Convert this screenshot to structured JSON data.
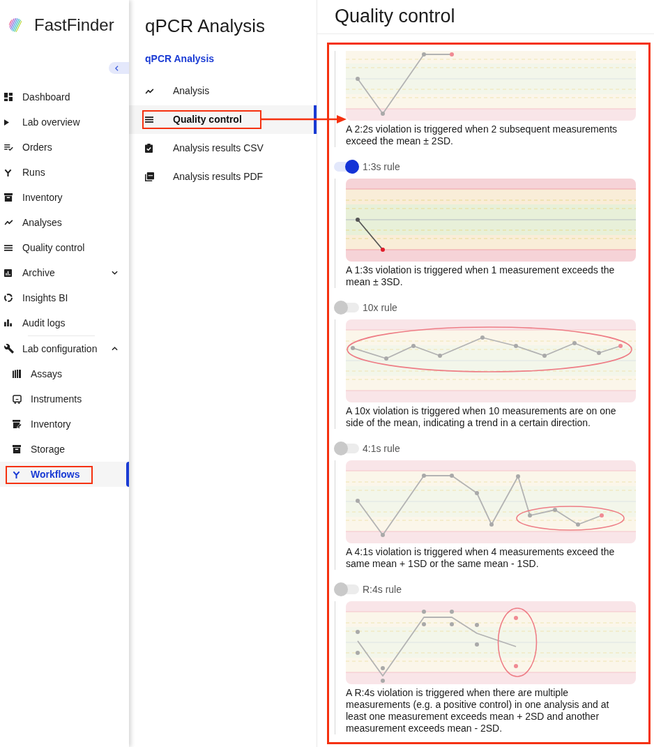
{
  "sidebar": {
    "brand": "FastFinder",
    "items": [
      {
        "label": "Dashboard",
        "selected": false,
        "highlighted": false
      },
      {
        "label": "Lab overview",
        "selected": false,
        "highlighted": false
      },
      {
        "label": "Orders",
        "selected": false,
        "highlighted": false
      },
      {
        "label": "Runs",
        "selected": false,
        "highlighted": false
      },
      {
        "label": "Inventory",
        "selected": false,
        "highlighted": false
      },
      {
        "label": "Analyses",
        "selected": false,
        "highlighted": false
      },
      {
        "label": "Quality control",
        "selected": false,
        "highlighted": false
      },
      {
        "label": "Archive",
        "selected": false,
        "highlighted": false,
        "expanded": false
      },
      {
        "label": "Insights BI",
        "selected": false,
        "highlighted": false
      },
      {
        "label": "Audit logs",
        "selected": false,
        "highlighted": false
      },
      {
        "label": "Lab configuration",
        "selected": false,
        "highlighted": false,
        "expanded": true,
        "children": [
          {
            "label": "Assays",
            "selected": false,
            "highlighted": false
          },
          {
            "label": "Instruments",
            "selected": false,
            "highlighted": false
          },
          {
            "label": "Inventory",
            "selected": false,
            "highlighted": false
          },
          {
            "label": "Storage",
            "selected": false,
            "highlighted": false
          },
          {
            "label": "Workflows",
            "selected": true,
            "highlighted": true
          }
        ]
      }
    ]
  },
  "subnav": {
    "title": "qPCR Analysis",
    "section": "qPCR Analysis",
    "items": [
      {
        "label": "Analysis",
        "selected": false,
        "highlighted": false
      },
      {
        "label": "Quality control",
        "selected": true,
        "highlighted": true
      },
      {
        "label": "Analysis results CSV",
        "selected": false,
        "highlighted": false
      },
      {
        "label": "Analysis results PDF",
        "selected": false,
        "highlighted": false
      }
    ]
  },
  "content": {
    "title": "Quality control",
    "highlighted": true,
    "rules": [
      {
        "kind": "pair",
        "description": "A 2:2s violation is triggered when 2 subsequent measurements exceed the mean ± 2SD."
      },
      {
        "kind": "single",
        "label": "1:3s rule",
        "on": true,
        "description": "A 1:3s violation is triggered when 1 measurement exceeds the mean ± 3SD."
      },
      {
        "kind": "trend",
        "label": "10x rule",
        "on": false,
        "description": "A 10x violation is triggered when 10 measurements are on one side of the mean, indicating a trend in a certain direction."
      },
      {
        "kind": "shift",
        "label": "4:1s rule",
        "on": false,
        "description": "A 4:1s violation is triggered when 4 measurements exceed the same mean + 1SD or the same mean - 1SD."
      },
      {
        "kind": "range",
        "label": "R:4s rule",
        "on": false,
        "description": "A R:4s violation is triggered when there are multiple measurements (e.g. a positive control) in one analysis and at least one measurement exceeds mean + 2SD and another measurement exceeds mean - 2SD."
      }
    ]
  }
}
